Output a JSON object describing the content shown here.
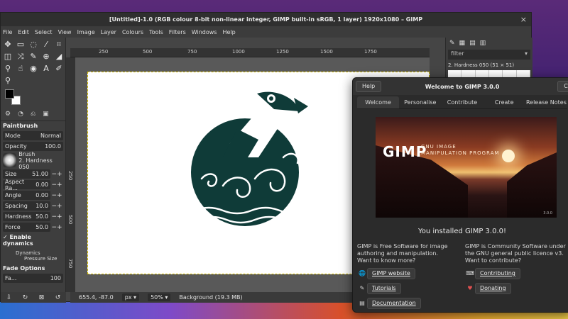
{
  "window": {
    "title": "[Untitled]-1.0 (RGB colour 8-bit non-linear integer, GIMP built-in sRGB, 1 layer) 1920x1080 – GIMP",
    "close_glyph": "×"
  },
  "menu": [
    "File",
    "Edit",
    "Select",
    "View",
    "Image",
    "Layer",
    "Colours",
    "Tools",
    "Filters",
    "Windows",
    "Help"
  ],
  "ruler_top": [
    "250",
    "500",
    "750",
    "1000",
    "1250",
    "1500",
    "1750"
  ],
  "ruler_left": [
    "250",
    "500",
    "750"
  ],
  "tool_options": {
    "title": "Paintbrush",
    "mode_label": "Mode",
    "mode_value": "Normal",
    "opacity_label": "Opacity",
    "opacity_value": "100.0",
    "brush_label": "Brush",
    "brush_value": "2. Hardness 050",
    "rows": [
      {
        "label": "Size",
        "value": "51.00"
      },
      {
        "label": "Aspect Ra...",
        "value": "0.00"
      },
      {
        "label": "Angle",
        "value": "0.00"
      },
      {
        "label": "Spacing",
        "value": "10.0"
      },
      {
        "label": "Hardness",
        "value": "50.0"
      },
      {
        "label": "Force",
        "value": "50.0"
      }
    ],
    "enable_dynamics": "Enable dynamics",
    "dynamics_label": "Dynamics",
    "dynamics_value": "Pressure Size",
    "fade_options": "Fade Options",
    "fade_value": "100"
  },
  "statusbar": {
    "coords": "655.4, -87.0",
    "unit": "px",
    "zoom": "50%",
    "info": "Background (19.3 MB)"
  },
  "right_dock": {
    "filter_placeholder": "filter",
    "brush_name": "2. Hardness 050 (51 × 51)"
  },
  "welcome": {
    "help_label": "Help",
    "title": "Welcome to GIMP 3.0.0",
    "close_label": "Close",
    "tabs": [
      "Welcome",
      "Personalise",
      "Contribute",
      "Create",
      "Release Notes"
    ],
    "splash_title": "GIMP",
    "splash_sub_1": "GNU IMAGE",
    "splash_sub_2": "MANIPULATION PROGRAM",
    "splash_version": "3.0.0",
    "installed": "You installed GIMP 3.0.0!",
    "left_text": "GIMP is Free Software for image authoring and manipulation.",
    "left_q": "Want to know more?",
    "right_text": "GIMP is Community Software under the GNU general public licence v3.",
    "right_q": "Want to contribute?",
    "links_left": [
      "GIMP website",
      "Tutorials",
      "Documentation"
    ],
    "links_right": [
      "Contributing",
      "Donating"
    ]
  },
  "colors": {
    "puffin": "#0f3b38",
    "accent": "#3a3a3a"
  }
}
